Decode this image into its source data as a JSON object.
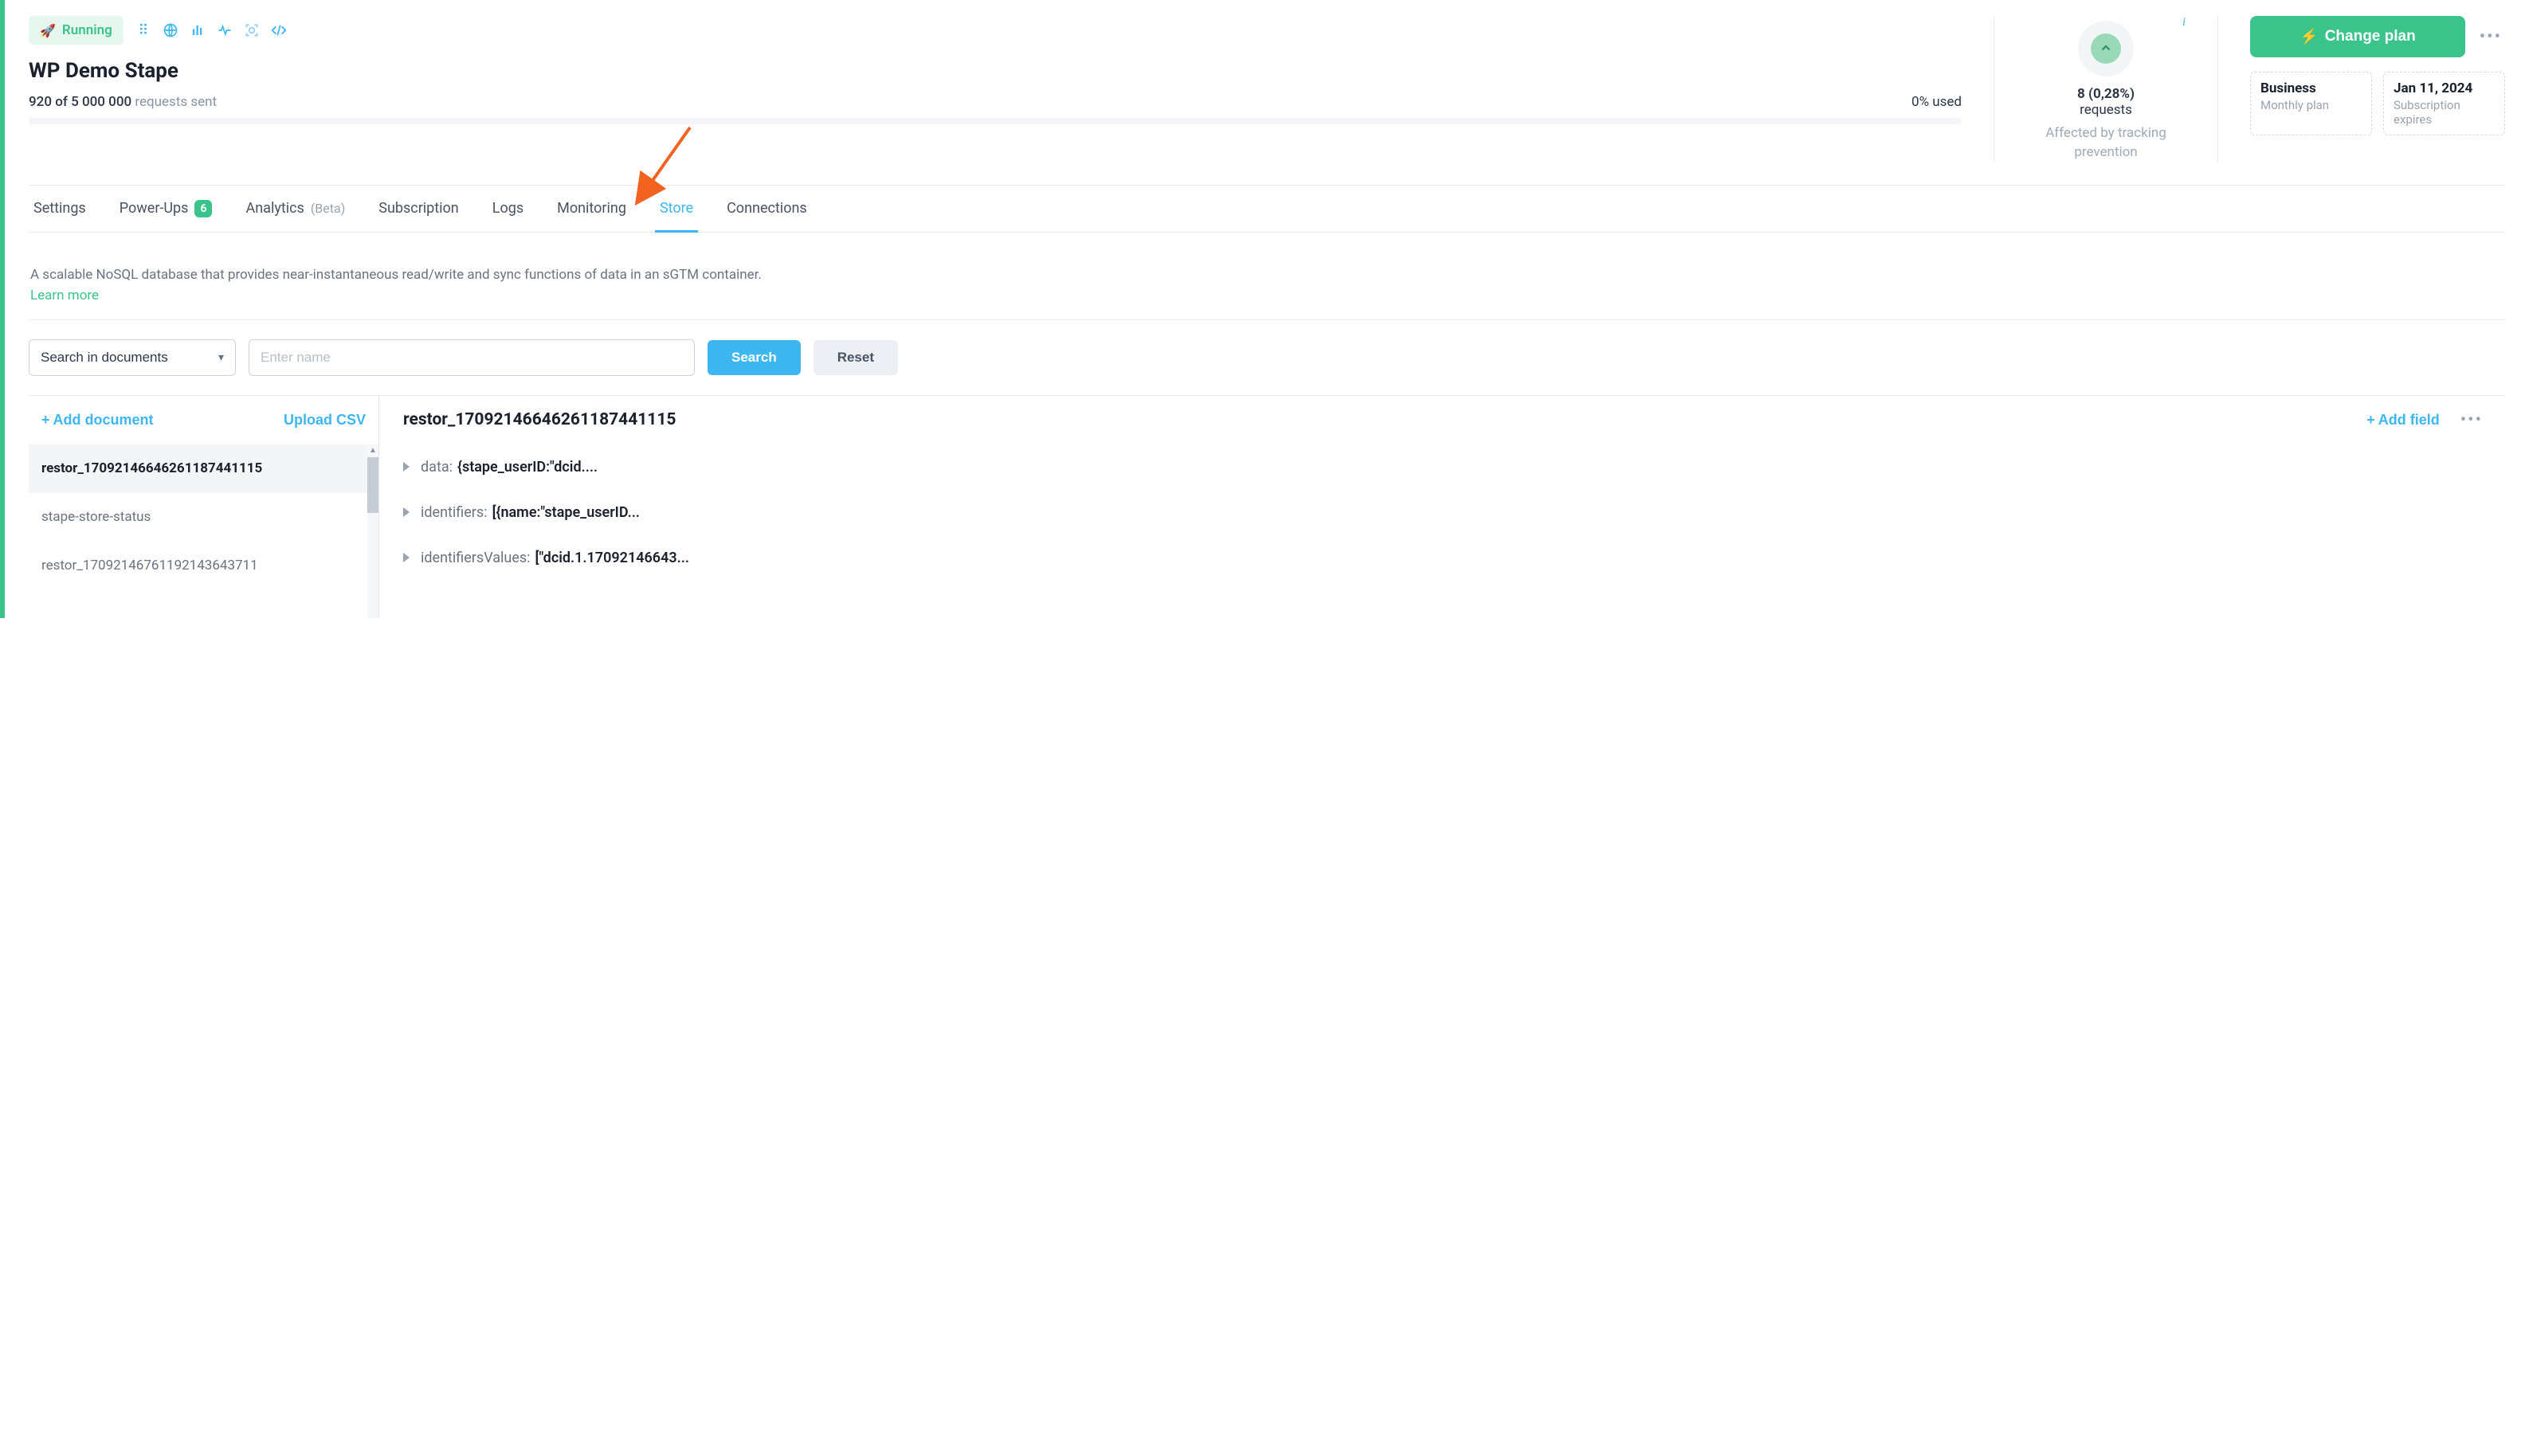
{
  "header": {
    "status_label": "Running",
    "page_title": "WP Demo Stape",
    "usage_text": "920 of 5 000 000",
    "usage_suffix": "requests sent",
    "percent_used": "0% used"
  },
  "icon_row": [
    "dots-icon",
    "globe-icon",
    "bars-icon",
    "heartbeat-icon",
    "face-scan-icon",
    "code-icon"
  ],
  "affected": {
    "count_line": "8 (0,28%)",
    "label": "requests",
    "sub": "Affected by tracking prevention"
  },
  "plan": {
    "change_label": "Change plan",
    "business_title": "Business",
    "business_sub": "Monthly plan",
    "expire_title": "Jan 11, 2024",
    "expire_sub": "Subscription expires"
  },
  "tabs": [
    {
      "id": "settings",
      "label": "Settings",
      "active": false
    },
    {
      "id": "power-ups",
      "label": "Power-Ups",
      "badge": "6",
      "active": false
    },
    {
      "id": "analytics",
      "label": "Analytics",
      "suffix": "(Beta)",
      "active": false
    },
    {
      "id": "subscription",
      "label": "Subscription",
      "active": false
    },
    {
      "id": "logs",
      "label": "Logs",
      "active": false
    },
    {
      "id": "monitoring",
      "label": "Monitoring",
      "active": false
    },
    {
      "id": "store",
      "label": "Store",
      "active": true
    },
    {
      "id": "connections",
      "label": "Connections",
      "active": false
    }
  ],
  "store": {
    "description": "A scalable NoSQL database that provides near-instantaneous read/write and sync functions of data in an sGTM container.",
    "learn_more": "Learn more",
    "filter": {
      "select_label": "Search in documents",
      "placeholder": "Enter name",
      "search_label": "Search",
      "reset_label": "Reset"
    },
    "doc_actions": {
      "add_document": "Add document",
      "upload_csv": "Upload CSV",
      "add_field": "Add field"
    },
    "documents": [
      {
        "id": "d1",
        "name": "restor_17092146646261187441115",
        "selected": true
      },
      {
        "id": "d2",
        "name": "stape-store-status",
        "selected": false
      },
      {
        "id": "d3",
        "name": "restor_17092146761192143643711",
        "selected": false
      }
    ],
    "detail": {
      "title": "restor_17092146646261187441115",
      "fields": [
        {
          "key": "data:",
          "value": "{stape_userID:\"dcid...."
        },
        {
          "key": "identifiers:",
          "value": "[{name:\"stape_userID..."
        },
        {
          "key": "identifiersValues:",
          "value": "[\"dcid.1.17092146643..."
        }
      ]
    }
  }
}
